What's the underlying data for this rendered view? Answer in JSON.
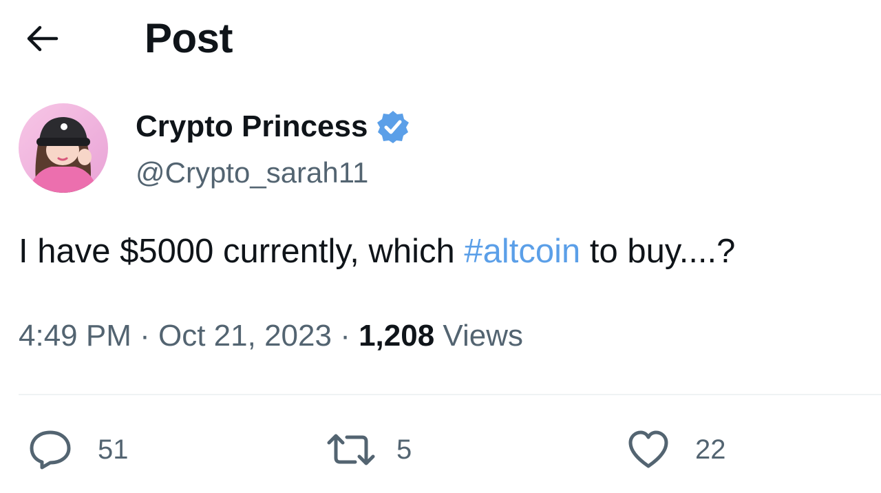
{
  "header": {
    "back_icon": "arrow-left-icon",
    "title": "Post"
  },
  "author": {
    "display_name": "Crypto Princess",
    "handle": "@Crypto_sarah11",
    "verified_icon": "verified-badge-icon",
    "verified_color": "#5b9fe8"
  },
  "post": {
    "text_before": "I have $5000 currently, which ",
    "hashtag": "#altcoin",
    "text_after": " to buy....?"
  },
  "meta": {
    "time": "4:49 PM",
    "separator": "·",
    "date": "Oct 21, 2023",
    "views_count": "1,208",
    "views_label": "Views"
  },
  "actions": {
    "reply_icon": "reply-icon",
    "reply_count": "51",
    "repost_icon": "repost-icon",
    "repost_count": "5",
    "like_icon": "heart-icon",
    "like_count": "22"
  },
  "colors": {
    "text": "#0f1419",
    "secondary": "#536471",
    "accent": "#5b9fe8",
    "divider": "#eff3f4"
  }
}
